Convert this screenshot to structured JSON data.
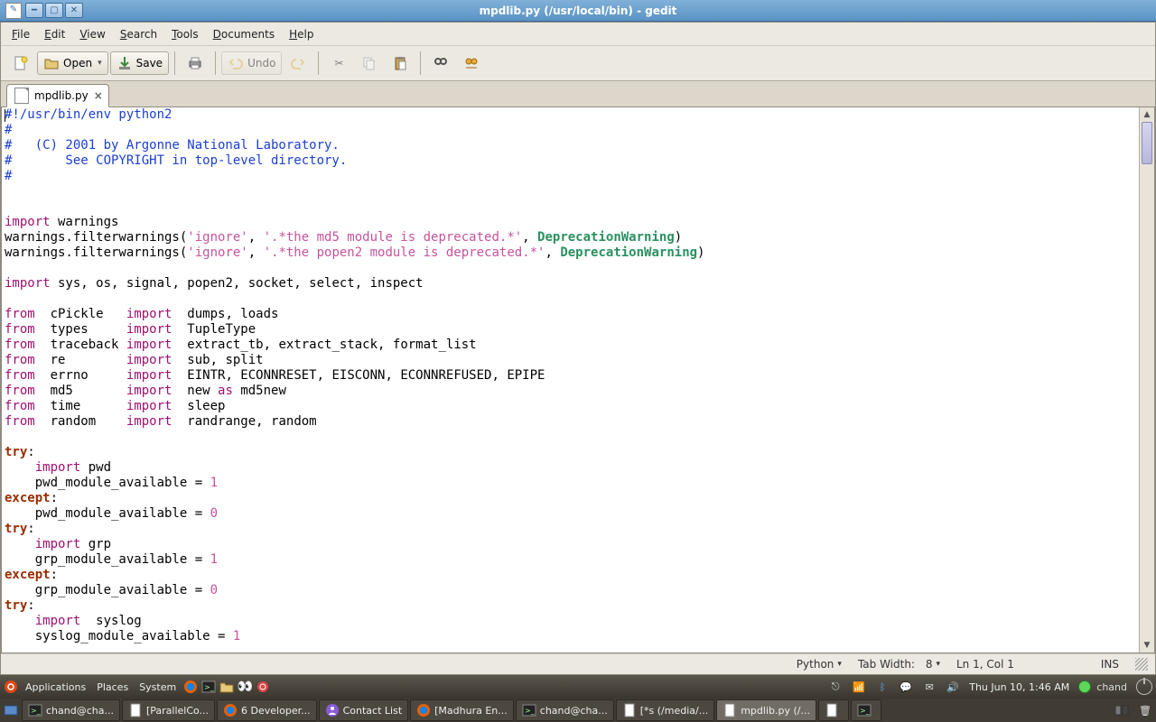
{
  "window": {
    "title": "mpdlib.py (/usr/local/bin) - gedit"
  },
  "menus": {
    "file": "File",
    "edit": "Edit",
    "view": "View",
    "search": "Search",
    "tools": "Tools",
    "documents": "Documents",
    "help": "Help"
  },
  "toolbar": {
    "open": "Open",
    "save": "Save",
    "undo": "Undo"
  },
  "tab": {
    "name": "mpdlib.py"
  },
  "status": {
    "lang": "Python",
    "tabwidth_label": "Tab Width:",
    "tabwidth": "8",
    "pos": "Ln 1, Col 1",
    "mode": "INS"
  },
  "top_panel": {
    "apps": "Applications",
    "places": "Places",
    "system": "System",
    "clock": "Thu Jun 10,  1:46 AM",
    "user": "chand"
  },
  "tasks": [
    {
      "icon": "term",
      "label": "chand@cha..."
    },
    {
      "icon": "doc",
      "label": "[ParallelCo..."
    },
    {
      "icon": "ff",
      "label": "6 Developer..."
    },
    {
      "icon": "pid",
      "label": "Contact List"
    },
    {
      "icon": "ff",
      "label": "[Madhura En..."
    },
    {
      "icon": "term",
      "label": "chand@cha..."
    },
    {
      "icon": "doc",
      "label": "[*s (/media/..."
    },
    {
      "icon": "doc",
      "label": "mpdlib.py (/...",
      "active": true
    },
    {
      "icon": "doc",
      "label": ""
    },
    {
      "icon": "term",
      "label": ""
    }
  ],
  "code_lines": [
    [
      [
        "c",
        "#!/usr/bin/env python2"
      ]
    ],
    [
      [
        "c",
        "#"
      ]
    ],
    [
      [
        "c",
        "#   (C) 2001 by Argonne National Laboratory."
      ]
    ],
    [
      [
        "c",
        "#       See COPYRIGHT in top-level directory."
      ]
    ],
    [
      [
        "c",
        "#"
      ]
    ],
    [
      [
        "p",
        ""
      ]
    ],
    [
      [
        "p",
        ""
      ]
    ],
    [
      [
        "kw",
        "import"
      ],
      [
        "p",
        " warnings"
      ]
    ],
    [
      [
        "p",
        "warnings.filterwarnings("
      ],
      [
        "str",
        "'ignore'"
      ],
      [
        "p",
        ", "
      ],
      [
        "str",
        "'.*the md5 module is deprecated.*'"
      ],
      [
        "p",
        ", "
      ],
      [
        "typ",
        "DeprecationWarning"
      ],
      [
        "p",
        ")"
      ]
    ],
    [
      [
        "p",
        "warnings.filterwarnings("
      ],
      [
        "str",
        "'ignore'"
      ],
      [
        "p",
        ", "
      ],
      [
        "str",
        "'.*the popen2 module is deprecated.*'"
      ],
      [
        "p",
        ", "
      ],
      [
        "typ",
        "DeprecationWarning"
      ],
      [
        "p",
        ")"
      ]
    ],
    [
      [
        "p",
        ""
      ]
    ],
    [
      [
        "kw",
        "import"
      ],
      [
        "p",
        " sys, os, signal, popen2, socket, select, inspect"
      ]
    ],
    [
      [
        "p",
        ""
      ]
    ],
    [
      [
        "kw",
        "from"
      ],
      [
        "p",
        "  cPickle   "
      ],
      [
        "kw",
        "import"
      ],
      [
        "p",
        "  dumps, loads"
      ]
    ],
    [
      [
        "kw",
        "from"
      ],
      [
        "p",
        "  types     "
      ],
      [
        "kw",
        "import"
      ],
      [
        "p",
        "  TupleType"
      ]
    ],
    [
      [
        "kw",
        "from"
      ],
      [
        "p",
        "  traceback "
      ],
      [
        "kw",
        "import"
      ],
      [
        "p",
        "  extract_tb, extract_stack, format_list"
      ]
    ],
    [
      [
        "kw",
        "from"
      ],
      [
        "p",
        "  re        "
      ],
      [
        "kw",
        "import"
      ],
      [
        "p",
        "  sub, split"
      ]
    ],
    [
      [
        "kw",
        "from"
      ],
      [
        "p",
        "  errno     "
      ],
      [
        "kw",
        "import"
      ],
      [
        "p",
        "  EINTR, ECONNRESET, EISCONN, ECONNREFUSED, EPIPE"
      ]
    ],
    [
      [
        "kw",
        "from"
      ],
      [
        "p",
        "  md5       "
      ],
      [
        "kw",
        "import"
      ],
      [
        "p",
        "  new "
      ],
      [
        "kw",
        "as"
      ],
      [
        "p",
        " md5new"
      ]
    ],
    [
      [
        "kw",
        "from"
      ],
      [
        "p",
        "  time      "
      ],
      [
        "kw",
        "import"
      ],
      [
        "p",
        "  sleep"
      ]
    ],
    [
      [
        "kw",
        "from"
      ],
      [
        "p",
        "  random    "
      ],
      [
        "kw",
        "import"
      ],
      [
        "p",
        "  randrange, random"
      ]
    ],
    [
      [
        "p",
        ""
      ]
    ],
    [
      [
        "co",
        "try"
      ],
      [
        "p",
        ":"
      ]
    ],
    [
      [
        "p",
        "    "
      ],
      [
        "kw",
        "import"
      ],
      [
        "p",
        " pwd"
      ]
    ],
    [
      [
        "p",
        "    pwd_module_available = "
      ],
      [
        "num",
        "1"
      ]
    ],
    [
      [
        "co",
        "except"
      ],
      [
        "p",
        ":"
      ]
    ],
    [
      [
        "p",
        "    pwd_module_available = "
      ],
      [
        "num",
        "0"
      ]
    ],
    [
      [
        "co",
        "try"
      ],
      [
        "p",
        ":"
      ]
    ],
    [
      [
        "p",
        "    "
      ],
      [
        "kw",
        "import"
      ],
      [
        "p",
        " grp"
      ]
    ],
    [
      [
        "p",
        "    grp_module_available = "
      ],
      [
        "num",
        "1"
      ]
    ],
    [
      [
        "co",
        "except"
      ],
      [
        "p",
        ":"
      ]
    ],
    [
      [
        "p",
        "    grp_module_available = "
      ],
      [
        "num",
        "0"
      ]
    ],
    [
      [
        "co",
        "try"
      ],
      [
        "p",
        ":"
      ]
    ],
    [
      [
        "p",
        "    "
      ],
      [
        "kw",
        "import"
      ],
      [
        "p",
        "  syslog"
      ]
    ],
    [
      [
        "p",
        "    syslog_module_available = "
      ],
      [
        "num",
        "1"
      ]
    ]
  ]
}
